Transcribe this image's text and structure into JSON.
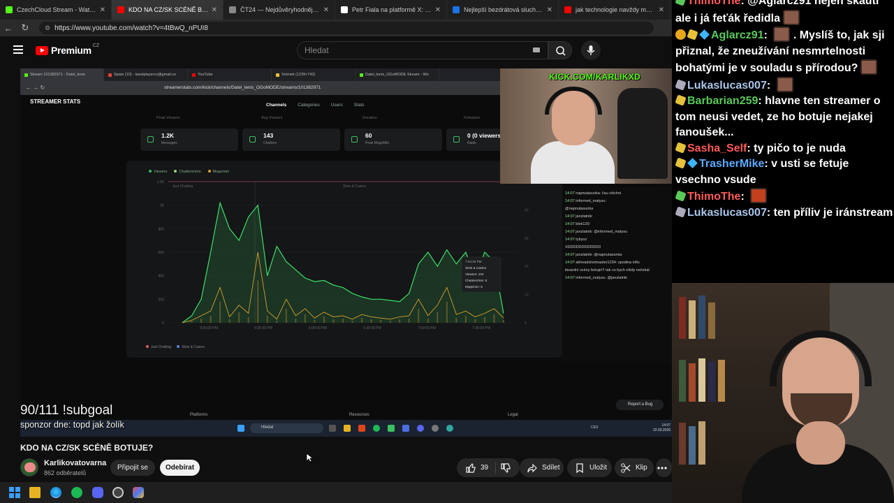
{
  "browser": {
    "tabs": [
      {
        "title": "CzechCloud Stream - Watch Live o",
        "color": "#53fc18",
        "active": false
      },
      {
        "title": "KDO NA CZ/SK SCÉNĚ BOTUJE?",
        "color": "#ff0000",
        "active": true
      },
      {
        "title": "ČT24 — Nejdůvěryhodnější zprav",
        "color": "#888888",
        "active": false
      },
      {
        "title": "Petr Fiala na platformě X: „100 dn",
        "color": "#ffffff",
        "active": false
      },
      {
        "title": "Nejlepší bezdrátová sluchátka 202",
        "color": "#1a73e8",
        "active": false
      },
      {
        "title": "jak technologie navždy mění to, c",
        "color": "#ff0000",
        "active": false
      }
    ],
    "url": "https://www.youtube.com/watch?v=4tBwQ_nPUI8"
  },
  "youtube": {
    "logo_text": "Premium",
    "logo_country": "CZ",
    "search_placeholder": "Hledat"
  },
  "video": {
    "inner_tabs": [
      "Stream 101382971 - Datel_lenis",
      "Spam (10) - karelplayercz@gmail.co",
      "YouTube",
      "Snímek (1239×742)",
      "Datel_lenis_OGoMODE Stream - Wo"
    ],
    "inner_url": "streamerstats.com/kick/channels/Datel_lenis_OGoMODE/streams/101382971",
    "site_logo": "STREAMER STATS",
    "menu": [
      "Channels",
      "Categories",
      "Users",
      "Stats"
    ],
    "faint_labels": [
      "Peak Viewers",
      "Avg Viewers",
      "Duration",
      "Followers"
    ],
    "stats": [
      {
        "value": "1.2K",
        "label": "Messages"
      },
      {
        "value": "143",
        "label": "Chatters"
      },
      {
        "value": "60",
        "label": "Peak Msgs/Min"
      },
      {
        "value": "0 (0 viewers)",
        "label": "Raids"
      }
    ],
    "kick_text": "KICK.COM/KARLIKXD",
    "chart_footer": [
      "Just Chatting",
      "Slots & Casino"
    ],
    "minichat": [
      {
        "n": "14:07",
        "t": "napnutasunka: čau všichni"
      },
      {
        "n": "14:07",
        "t": "informed_matysu:"
      },
      {
        "n": "",
        "t": "@napnutasunka"
      },
      {
        "n": "14:07",
        "t": "janzlatnik:"
      },
      {
        "n": "14:07",
        "t": "blek120:"
      },
      {
        "n": "14:07",
        "t": "janzlatnik: @informed_matysu"
      },
      {
        "n": "14:07",
        "t": "tybyuz"
      },
      {
        "n": "",
        "t": "XDDDDDDDDDDDD"
      },
      {
        "n": "14:07",
        "t": "janzlatnik: @napnutasunka"
      },
      {
        "n": "14:07",
        "t": "akheadshotmaster1234: spodina influ"
      },
      {
        "n": "",
        "t": "bizardní scény botuje!!! tak co bych nikdy nečekal"
      },
      {
        "n": "14:07",
        "t": "informed_matysu: @janzlatnik"
      }
    ],
    "subgoal": "90/111 !subgoal",
    "sponsor": "sponzor dne: topd jak žolík",
    "footer_links": [
      "Platforms",
      "Resources",
      "Legal"
    ],
    "report_bug": "Report a Bug",
    "inner_search": "Hledat",
    "inner_tray": "CES",
    "inner_clock_time": "14:07",
    "inner_clock_date": "22.03.2026"
  },
  "chart_data": {
    "type": "line",
    "title": "",
    "series_legend": [
      "Viewers",
      "Chatters/min",
      "Msgs/min"
    ],
    "y_ticks": [
      "1.2K",
      "1K",
      "800",
      "600",
      "400",
      "200",
      "0"
    ],
    "x_ticks": [
      "5:00:00 PM",
      "5:30:00 PM",
      "6:00:00 PM",
      "6:30:00 PM",
      "7:00:00 PM",
      "7:30:00 PM"
    ],
    "right_ticks": [
      "50",
      "40",
      "30",
      "20",
      "10",
      "0"
    ],
    "segments": [
      "Just Chatting",
      "Slots & Casino"
    ],
    "viewers": [
      0,
      60,
      200,
      600,
      1020,
      800,
      700,
      900,
      1000,
      400,
      650,
      520,
      450,
      380,
      350,
      360,
      320,
      300,
      250,
      220,
      200,
      200,
      190,
      180,
      250,
      500,
      600,
      480,
      620,
      500,
      600,
      380,
      600,
      520,
      80
    ],
    "msgs": [
      0,
      20,
      60,
      100,
      300,
      50,
      150,
      80,
      600,
      100,
      30,
      200,
      60,
      120,
      40,
      90,
      50,
      60,
      30,
      70,
      50,
      40,
      30,
      50,
      60,
      200,
      60,
      150,
      300,
      70,
      100,
      50,
      80,
      120,
      40
    ],
    "tooltip": {
      "time": "7:53:30 PM",
      "category": "Slots & Casino",
      "viewers": "Viewers: 104",
      "chatters": "Chatters/min: 8",
      "msgs": "Msgs/min: 8"
    }
  },
  "below_video": {
    "title": "KDO NA CZ/SK SCÉNĚ BOTUJE?",
    "channel": "Karlikovatovarna",
    "subscribers": "862 odběratelů",
    "join_label": "Připojit se",
    "subscribe_label": "Odebírat",
    "likes": "39",
    "share_label": "Sdílet",
    "save_label": "Uložit",
    "clip_label": "Klip"
  },
  "chat": [
    {
      "badges": [
        "g"
      ],
      "user": "ThimoThe",
      "user_color": "#ff5a5a",
      "text": "@Aglarcz91 nejen skauti ale i já feťák ředidla",
      "emote": true
    },
    {
      "badges": [
        "o",
        "y",
        "b"
      ],
      "user": "Aglarcz91",
      "user_color": "#5ac95a",
      "text": "",
      "emote": true,
      "text2": ". Myslíš to, jak sji přiznal, že zneužívání nesmrtelnosti bohatými je v souladu s přírodou?",
      "emote2": true
    },
    {
      "badges": [
        "s"
      ],
      "user": "Lukaslucas007",
      "user_color": "#a9c4e8",
      "text": "",
      "emote": true
    },
    {
      "badges": [
        "y"
      ],
      "user": "Barbarian259",
      "user_color": "#5ac95a",
      "text": "hlavne ten streamer o tom neusi vedet, ze ho botuje nejakej fanoušek...",
      "emote": false
    },
    {
      "badges": [
        "y"
      ],
      "user": "Sasha_Self",
      "user_color": "#ff5a5a",
      "text": "ty pičo to je nuda",
      "emote": false
    },
    {
      "badges": [
        "y",
        "b"
      ],
      "user": "TrasherMike",
      "user_color": "#5aaaff",
      "text": "v usti se fetuje vsechno vsude",
      "emote": false
    },
    {
      "badges": [
        "g"
      ],
      "user": "ThimoThe",
      "user_color": "#ff5a5a",
      "text": "",
      "emote": true
    },
    {
      "badges": [
        "s"
      ],
      "user": "Lukaslucas007",
      "user_color": "#a9c4e8",
      "text": "ten příliv je iránstream",
      "emote": false
    }
  ]
}
